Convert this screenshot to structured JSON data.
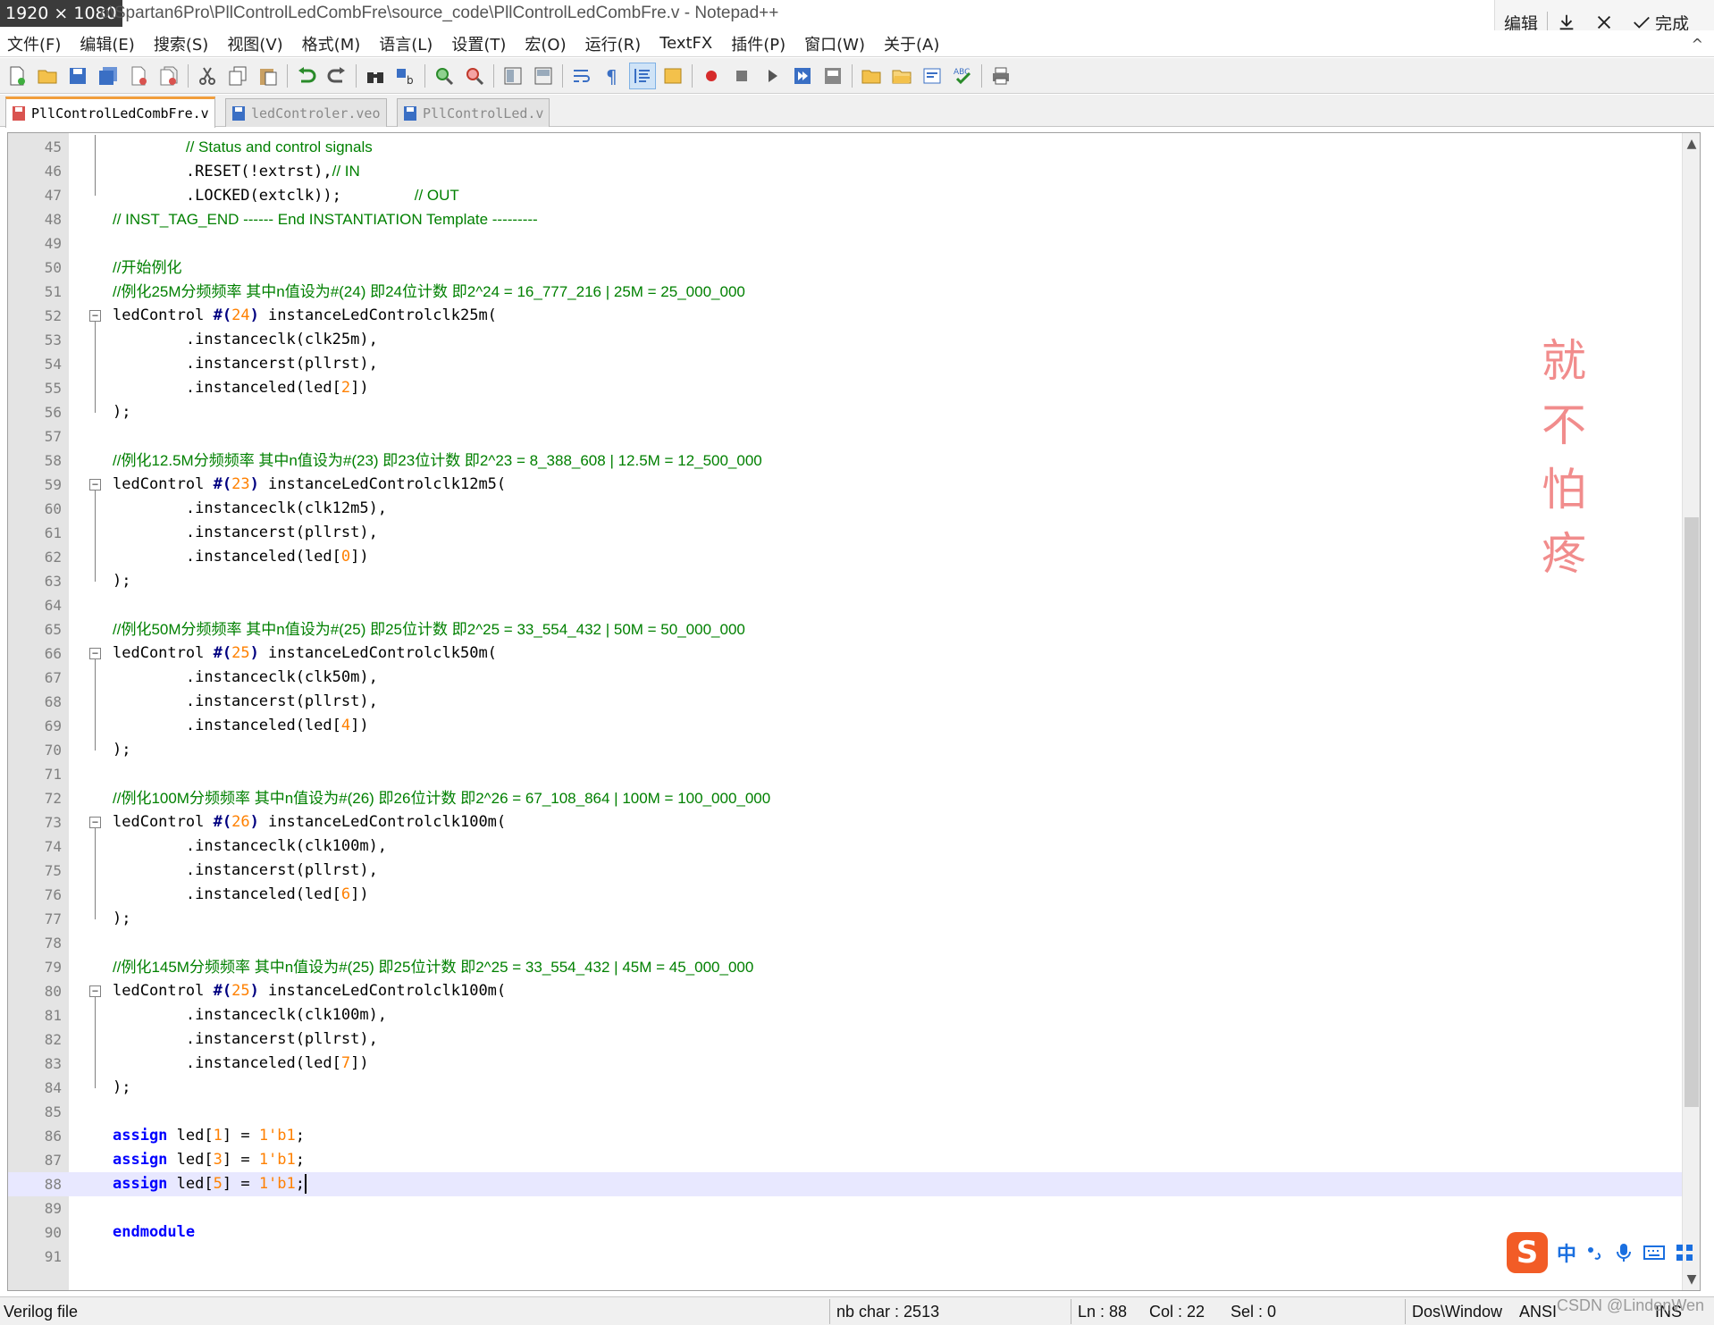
{
  "window": {
    "dimension_badge": "1920 × 1080",
    "title": "o\\Spartan6Pro\\PllControlLedCombFre\\source_code\\PllControlLedCombFre.v - Notepad++"
  },
  "screenshot_bar": {
    "edit_label": "编辑",
    "done_label": "完成"
  },
  "menu": [
    "文件(F)",
    "编辑(E)",
    "搜索(S)",
    "视图(V)",
    "格式(M)",
    "语言(L)",
    "设置(T)",
    "宏(O)",
    "运行(R)",
    "TextFX",
    "插件(P)",
    "窗口(W)",
    "关于(A)"
  ],
  "menu_collapse": "^",
  "tabs": [
    {
      "label": "PllControlLedCombFre.v",
      "active": true
    },
    {
      "label": "ledControler.veo",
      "active": false
    },
    {
      "label": "PllControlLed.v",
      "active": false
    }
  ],
  "editor": {
    "first_line": 45,
    "current_line": 88,
    "lines": [
      [
        [
          "",
          "        "
        ],
        [
          "comment",
          "// Status and control signals"
        ]
      ],
      [
        [
          "",
          "        .RESET(!extrst),"
        ],
        [
          "comment",
          "// IN"
        ]
      ],
      [
        [
          "",
          "        .LOCKED(extclk));        "
        ],
        [
          "comment",
          "// OUT"
        ]
      ],
      [
        [
          "comment",
          "// INST_TAG_END ------ End INSTANTIATION Template ---------"
        ]
      ],
      [],
      [
        [
          "comment",
          "//开始例化"
        ]
      ],
      [
        [
          "comment",
          "//例化25M分频频率 其中n值设为#(24) 即24位计数 即2^24 = 16_777_216 | 25M = 25_000_000"
        ]
      ],
      [
        [
          "",
          "ledControl "
        ],
        [
          "op",
          "#("
        ],
        [
          "num",
          "24"
        ],
        [
          "op",
          ")"
        ],
        [
          "",
          " instanceLedControlclk25m("
        ]
      ],
      [
        [
          "",
          "        .instanceclk(clk25m),"
        ]
      ],
      [
        [
          "",
          "        .instancerst(pllrst),"
        ]
      ],
      [
        [
          "",
          "        .instanceled(led["
        ],
        [
          "num",
          "2"
        ],
        [
          "",
          "])"
        ]
      ],
      [
        [
          "",
          ");"
        ]
      ],
      [],
      [
        [
          "comment",
          "//例化12.5M分频频率 其中n值设为#(23) 即23位计数 即2^23 = 8_388_608 | 12.5M = 12_500_000"
        ]
      ],
      [
        [
          "",
          "ledControl "
        ],
        [
          "op",
          "#("
        ],
        [
          "num",
          "23"
        ],
        [
          "op",
          ")"
        ],
        [
          "",
          " instanceLedControlclk12m5("
        ]
      ],
      [
        [
          "",
          "        .instanceclk(clk12m5),"
        ]
      ],
      [
        [
          "",
          "        .instancerst(pllrst),"
        ]
      ],
      [
        [
          "",
          "        .instanceled(led["
        ],
        [
          "num",
          "0"
        ],
        [
          "",
          "])"
        ]
      ],
      [
        [
          "",
          ");"
        ]
      ],
      [],
      [
        [
          "comment",
          "//例化50M分频频率 其中n值设为#(25) 即25位计数 即2^25 = 33_554_432 | 50M = 50_000_000"
        ]
      ],
      [
        [
          "",
          "ledControl "
        ],
        [
          "op",
          "#("
        ],
        [
          "num",
          "25"
        ],
        [
          "op",
          ")"
        ],
        [
          "",
          " instanceLedControlclk50m("
        ]
      ],
      [
        [
          "",
          "        .instanceclk(clk50m),"
        ]
      ],
      [
        [
          "",
          "        .instancerst(pllrst),"
        ]
      ],
      [
        [
          "",
          "        .instanceled(led["
        ],
        [
          "num",
          "4"
        ],
        [
          "",
          "])"
        ]
      ],
      [
        [
          "",
          ");"
        ]
      ],
      [],
      [
        [
          "comment",
          "//例化100M分频频率 其中n值设为#(26) 即26位计数 即2^26 = 67_108_864 | 100M = 100_000_000"
        ]
      ],
      [
        [
          "",
          "ledControl "
        ],
        [
          "op",
          "#("
        ],
        [
          "num",
          "26"
        ],
        [
          "op",
          ")"
        ],
        [
          "",
          " instanceLedControlclk100m("
        ]
      ],
      [
        [
          "",
          "        .instanceclk(clk100m),"
        ]
      ],
      [
        [
          "",
          "        .instancerst(pllrst),"
        ]
      ],
      [
        [
          "",
          "        .instanceled(led["
        ],
        [
          "num",
          "6"
        ],
        [
          "",
          "])"
        ]
      ],
      [
        [
          "",
          ");"
        ]
      ],
      [],
      [
        [
          "comment",
          "//例化145M分频频率 其中n值设为#(25) 即25位计数 即2^25 = 33_554_432 | 45M = 45_000_000"
        ]
      ],
      [
        [
          "",
          "ledControl "
        ],
        [
          "op",
          "#("
        ],
        [
          "num",
          "25"
        ],
        [
          "op",
          ")"
        ],
        [
          "",
          " instanceLedControlclk100m("
        ]
      ],
      [
        [
          "",
          "        .instanceclk(clk100m),"
        ]
      ],
      [
        [
          "",
          "        .instancerst(pllrst),"
        ]
      ],
      [
        [
          "",
          "        .instanceled(led["
        ],
        [
          "num",
          "7"
        ],
        [
          "",
          "])"
        ]
      ],
      [
        [
          "",
          ");"
        ]
      ],
      [],
      [
        [
          "kw",
          "assign"
        ],
        [
          "",
          " led["
        ],
        [
          "num",
          "1"
        ],
        [
          "",
          "] = "
        ],
        [
          "num",
          "1'b1"
        ],
        [
          "",
          ";"
        ]
      ],
      [
        [
          "kw",
          "assign"
        ],
        [
          "",
          " led["
        ],
        [
          "num",
          "3"
        ],
        [
          "",
          "] = "
        ],
        [
          "num",
          "1'b1"
        ],
        [
          "",
          ";"
        ]
      ],
      [
        [
          "kw",
          "assign"
        ],
        [
          "",
          " led["
        ],
        [
          "num",
          "5"
        ],
        [
          "",
          "] = "
        ],
        [
          "num",
          "1'b1"
        ],
        [
          "",
          ";"
        ]
      ],
      [],
      [
        [
          "kw",
          "endmodule"
        ]
      ],
      []
    ],
    "fold_starts": [
      52,
      59,
      66,
      73,
      80
    ],
    "fold_ends": [
      56,
      63,
      70,
      77,
      84
    ],
    "fold_continuation": [
      45,
      46,
      47
    ]
  },
  "watermark_stamp": "就\n不\n怕\n疼",
  "ime": {
    "logo": "S",
    "mode": "中"
  },
  "status": {
    "file_type": "Verilog file",
    "nb_char": "nb char : 2513",
    "ln": "Ln : 88",
    "col": "Col : 22",
    "sel": "Sel : 0",
    "eol": "Dos\\Window",
    "encoding": "ANSI",
    "ins": "INS"
  },
  "csdn_watermark": "CSDN @LindenWen",
  "colors": {
    "comment": "#008000",
    "keyword": "#0000ff",
    "number": "#ff8000",
    "operator": "#000080",
    "active_tab_accent": "#f19e3c",
    "current_line_bg": "#e8e8ff"
  }
}
